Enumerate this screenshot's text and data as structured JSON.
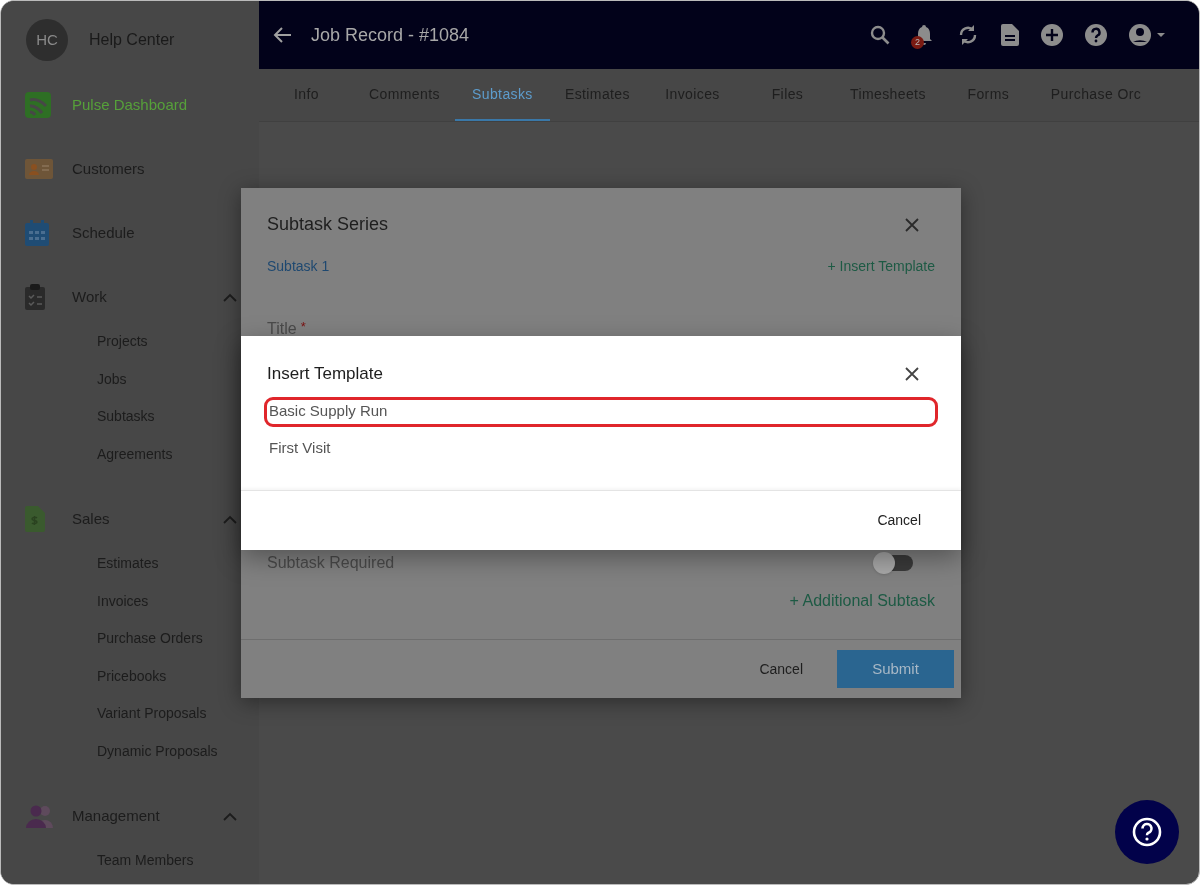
{
  "sidebar": {
    "user": {
      "initials": "HC",
      "name": "Help Center"
    },
    "items": [
      {
        "label": "Pulse Dashboard",
        "kind": "pulse",
        "selected": true
      },
      {
        "label": "Customers",
        "kind": "customers",
        "selected": false
      },
      {
        "label": "Schedule",
        "kind": "schedule",
        "selected": false
      },
      {
        "label": "Work",
        "kind": "work",
        "selected": false,
        "expanded": true,
        "children": [
          {
            "label": "Projects",
            "selected": false
          },
          {
            "label": "Jobs",
            "selected": false
          },
          {
            "label": "Subtasks",
            "selected": false
          },
          {
            "label": "Agreements",
            "selected": false
          }
        ]
      },
      {
        "label": "Sales",
        "kind": "sales",
        "selected": false,
        "expanded": true,
        "children": [
          {
            "label": "Estimates",
            "selected": false
          },
          {
            "label": "Invoices",
            "selected": false
          },
          {
            "label": "Purchase Orders",
            "selected": false
          },
          {
            "label": "Pricebooks",
            "selected": false
          },
          {
            "label": "Variant Proposals",
            "selected": false
          },
          {
            "label": "Dynamic Proposals",
            "selected": false
          }
        ]
      },
      {
        "label": "Management",
        "kind": "management",
        "selected": false,
        "expanded": true,
        "children": [
          {
            "label": "Team Members",
            "selected": false
          }
        ]
      }
    ]
  },
  "header": {
    "title": "Job Record - #1084",
    "notification_count": "2"
  },
  "tabs": [
    {
      "label": "Info",
      "selected": false
    },
    {
      "label": "Comments",
      "selected": false
    },
    {
      "label": "Subtasks",
      "selected": true
    },
    {
      "label": "Estimates",
      "selected": false
    },
    {
      "label": "Invoices",
      "selected": false
    },
    {
      "label": "Files",
      "selected": false
    },
    {
      "label": "Timesheets",
      "selected": false
    },
    {
      "label": "Forms",
      "selected": false
    },
    {
      "label": "Purchase Orc",
      "selected": false
    }
  ],
  "dialog": {
    "title": "Subtask Series",
    "subtask_tab": "Subtask 1",
    "insert_template_link": "+ Insert Template",
    "title_label": "Title",
    "required_mark": "*",
    "toggle": {
      "label": "Subtask Required",
      "on": false
    },
    "add_link": "+ Additional Subtask",
    "cancel": "Cancel",
    "submit": "Submit"
  },
  "modal": {
    "title": "Insert Template",
    "templates": [
      {
        "label": "Basic Supply Run",
        "highlighted": true
      },
      {
        "label": "First Visit",
        "highlighted": false
      }
    ],
    "cancel": "Cancel"
  }
}
